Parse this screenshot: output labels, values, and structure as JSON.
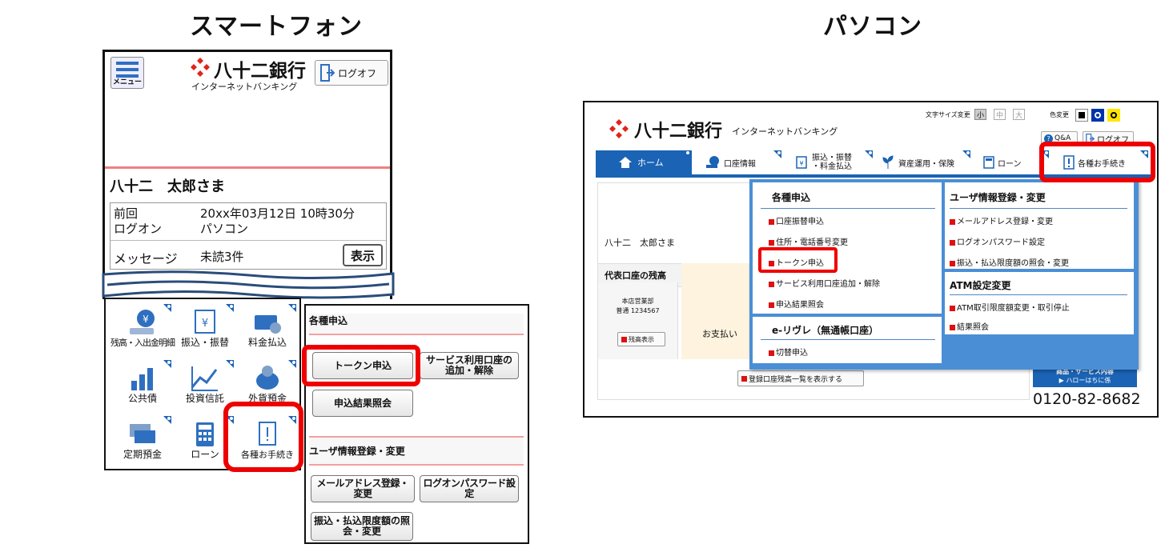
{
  "headings": {
    "smartphone": "スマートフォン",
    "pc": "パソコン"
  },
  "brand": {
    "name": "八十二銀行",
    "sub": "インターネットバンキング"
  },
  "sp": {
    "menu_label": "メニュー",
    "logoff": "ログオフ",
    "user_name": "八十二　太郎さま",
    "last_login_label": "前回\nログオン",
    "last_login_value": "20xx年03月12日 10時30分\nパソコン",
    "message_label": "メッセージ",
    "message_value": "未読3件",
    "show_button": "表示",
    "tiles": [
      {
        "label": "残高・入出金明細",
        "icon": "coin-icon"
      },
      {
        "label": "振込・振替",
        "icon": "transfer-icon"
      },
      {
        "label": "料金払込",
        "icon": "yen-card-icon"
      },
      {
        "label": "公共債",
        "icon": "chart-bar-icon"
      },
      {
        "label": "投資信託",
        "icon": "chart-line-icon"
      },
      {
        "label": "外貨預金",
        "icon": "piggy-icon"
      },
      {
        "label": "定期預金",
        "icon": "yen-notes-icon"
      },
      {
        "label": "ローン",
        "icon": "calculator-icon"
      },
      {
        "label": "各種お手続き",
        "icon": "document-icon"
      }
    ],
    "sub_panel": {
      "section1": "各種申込",
      "buttons1": [
        "トークン申込",
        "サービス利用口座の追加・解除",
        "申込結果照会"
      ],
      "section2": "ユーザ情報登録・変更",
      "buttons2": [
        "メールアドレス登録・変更",
        "ログオンパスワード設定",
        "振込・払込限度額の照会・変更"
      ]
    }
  },
  "pc": {
    "font_size_label": "文字サイズ変更",
    "font_sizes": [
      "小",
      "中",
      "大"
    ],
    "color_label": "色変更",
    "qa": "Q&A",
    "logoff": "ログオフ",
    "nav": [
      "ホーム",
      "口座情報",
      "振込・振替\n・料金払込",
      "資産運用・保険",
      "ローン",
      "各種お手続き"
    ],
    "user_name": "八十二　太郎さま",
    "balance_title": "代表口座の残高",
    "branch": "本店営業部",
    "account": "普通 1234567",
    "balance_btn": "残高表示",
    "payment_text": "お支払い",
    "list_btn": "登録口座残高一覧を表示する",
    "promo_line1": "商品・サービス内容",
    "promo_line2": "▶ ハローはちに係",
    "phone": "0120-82-8682",
    "dropdown": {
      "col1_title": "各種申込",
      "col1_items": [
        "口座振替申込",
        "住所・電話番号変更",
        "トークン申込",
        "サービス利用口座追加・解除",
        "申込結果照会"
      ],
      "col1b_title": "e-リヴレ（無通帳口座）",
      "col1b_items": [
        "切替申込"
      ],
      "col2_title": "ユーザ情報登録・変更",
      "col2_items": [
        "メールアドレス登録・変更",
        "ログオンパスワード設定",
        "振込・払込限度額の照会・変更"
      ],
      "col2b_title": "ATM設定変更",
      "col2b_items": [
        "ATM取引限度額変更・取引停止",
        "結果照会"
      ]
    }
  },
  "colors": {
    "brand_red": "#e2231a",
    "nav_blue": "#1a63b5",
    "highlight": "#ee0000"
  }
}
